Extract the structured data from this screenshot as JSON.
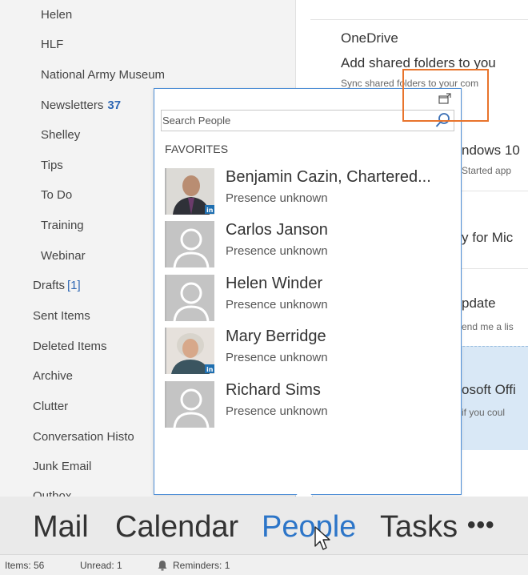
{
  "folders": {
    "helen": "Helen",
    "hlf": "HLF",
    "national_army_museum": "National Army Museum",
    "newsletters": "Newsletters",
    "newsletters_count": "37",
    "shelley": "Shelley",
    "tips": "Tips",
    "to_do": "To Do",
    "training": "Training",
    "webinar": "Webinar",
    "drafts": "Drafts",
    "drafts_count": "[1]",
    "sent_items": "Sent Items",
    "deleted_items": "Deleted Items",
    "archive": "Archive",
    "clutter": "Clutter",
    "conversation_history": "Conversation Histo",
    "junk_email": "Junk Email",
    "outbox": "Outbox"
  },
  "reading": {
    "onedrive_title": "OneDrive",
    "onedrive_line": "Add shared folders to you",
    "onedrive_sub": "Sync shared folders to your com",
    "win10_title": "ndows 10",
    "win10_sub": "Started app",
    "mic_title": "y for Mic",
    "update_title": "pdate",
    "update_sub": "end me a lis",
    "office_title": "osoft Offi",
    "office_sub": "if you coul"
  },
  "people_peek": {
    "search_placeholder": "Search People",
    "favorites_heading": "FAVORITES",
    "contacts": [
      {
        "name": "Benjamin Cazin, Chartered...",
        "presence": "Presence unknown",
        "avatar": "photo-linkedin"
      },
      {
        "name": "Carlos Janson",
        "presence": "Presence unknown",
        "avatar": "placeholder-person"
      },
      {
        "name": "Helen Winder",
        "presence": "Presence unknown",
        "avatar": "placeholder-person"
      },
      {
        "name": "Mary Berridge",
        "presence": "Presence unknown",
        "avatar": "photo-linkedin"
      },
      {
        "name": "Richard Sims",
        "presence": "Presence unknown",
        "avatar": "placeholder-person"
      }
    ]
  },
  "nav": {
    "mail": "Mail",
    "calendar": "Calendar",
    "people": "People",
    "tasks": "Tasks",
    "more": "•••",
    "active": "People"
  },
  "status": {
    "items": "Items: 56",
    "unread": "Unread: 1",
    "reminders": "Reminders: 1"
  },
  "colors": {
    "accent_blue": "#2c75c8",
    "count_blue": "#2f68b4",
    "highlight_orange": "#e8742c",
    "peek_border": "#4f8fd6"
  }
}
